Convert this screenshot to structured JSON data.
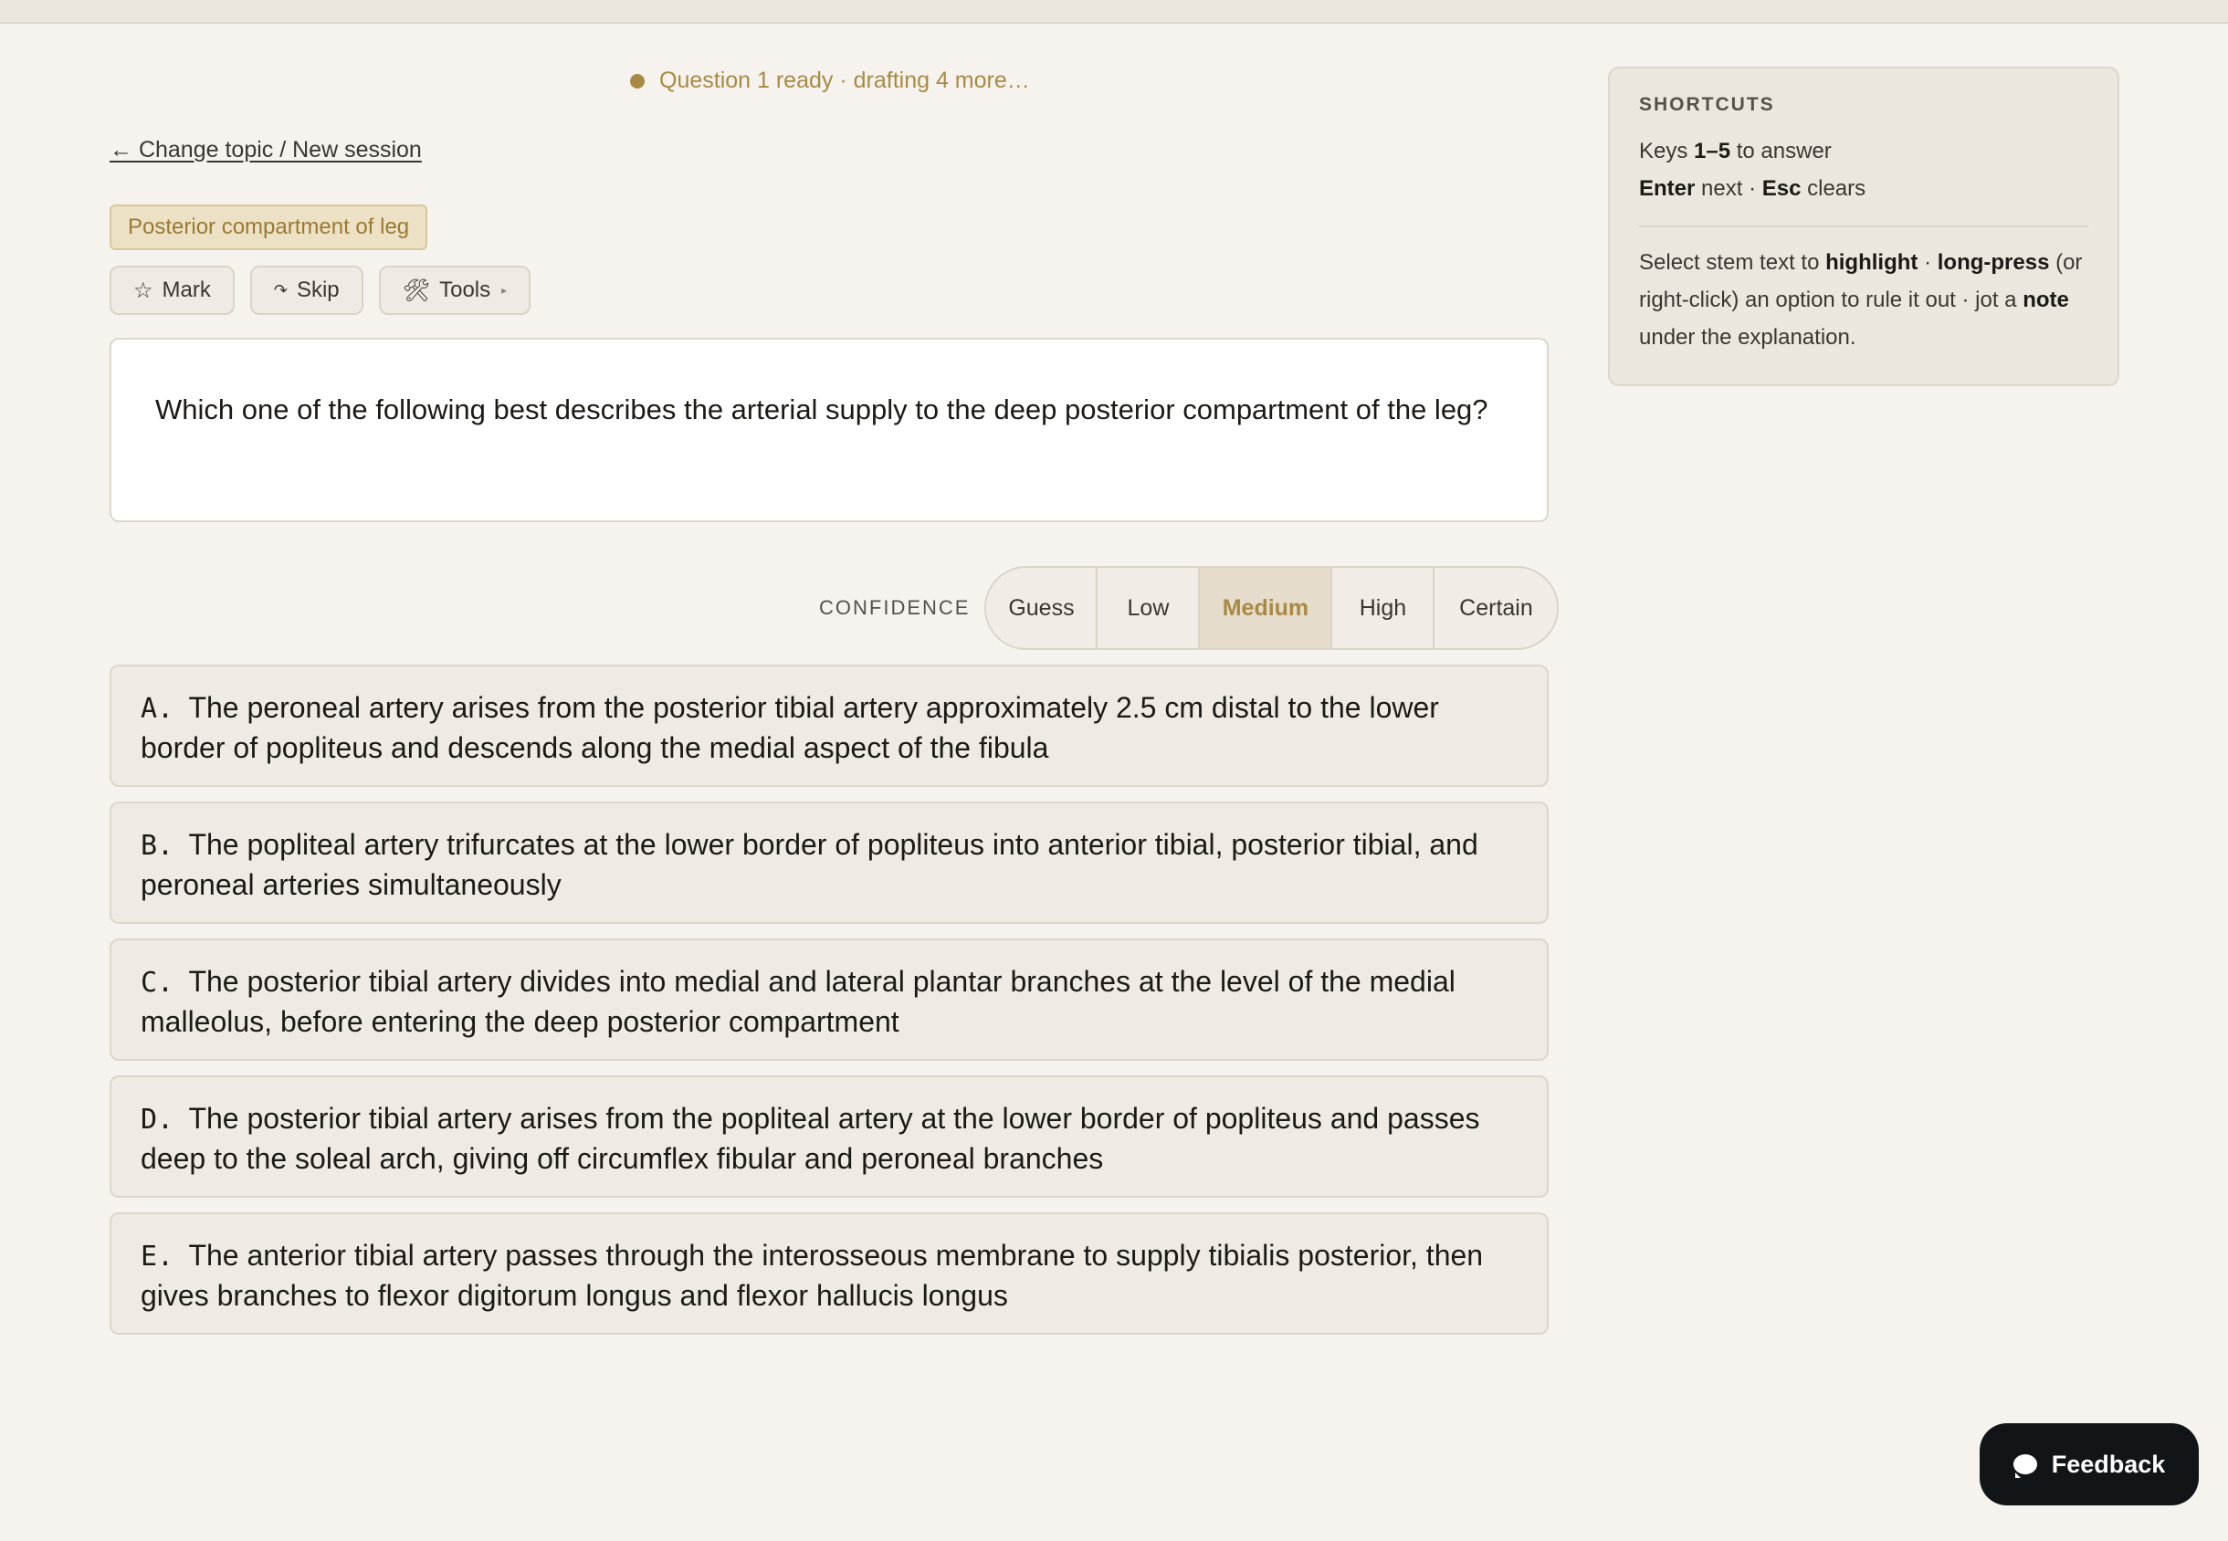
{
  "status": {
    "text": "Question 1 ready · drafting 4 more…"
  },
  "nav": {
    "back_link": "← Change topic / New session"
  },
  "topic": {
    "label": "Posterior compartment of leg"
  },
  "toolbar": {
    "mark_icon": "star-outline-icon",
    "mark_glyph": "☆",
    "mark_label": "Mark",
    "skip_icon": "skip-icon",
    "skip_glyph": "↷",
    "skip_label": "Skip",
    "tools_icon": "tools-icon",
    "tools_glyph": "🛠",
    "tools_label": "Tools",
    "tools_caret": "▸"
  },
  "question": {
    "stem": "Which one of the following best describes the arterial supply to the deep posterior compartment of the leg?"
  },
  "confidence": {
    "label": "CONFIDENCE",
    "selected": "Medium",
    "options": [
      "Guess",
      "Low",
      "Medium",
      "High",
      "Certain"
    ]
  },
  "options": [
    {
      "letter": "A.",
      "text": "The peroneal artery arises from the posterior tibial artery approximately 2.5 cm distal to the lower border of popliteus and descends along the medial aspect of the fibula"
    },
    {
      "letter": "B.",
      "text": "The popliteal artery trifurcates at the lower border of popliteus into anterior tibial, posterior tibial, and peroneal arteries simultaneously"
    },
    {
      "letter": "C.",
      "text": "The posterior tibial artery divides into medial and lateral plantar branches at the level of the medial malleolus, before entering the deep posterior compartment"
    },
    {
      "letter": "D.",
      "text": "The posterior tibial artery arises from the popliteal artery at the lower border of popliteus and passes deep to the soleal arch, giving off circumflex fibular and peroneal branches"
    },
    {
      "letter": "E.",
      "text": "The anterior tibial artery passes through the interosseous membrane to supply tibialis posterior, then gives branches to flexor digitorum longus and flexor hallucis longus"
    }
  ],
  "shortcuts": {
    "title": "SHORTCUTS",
    "keys": "1–5",
    "to_answer": "to answer",
    "enter": "Enter",
    "next": "next ·",
    "esc": "Esc",
    "clears": "clears",
    "select_text": "Select stem text to",
    "highlight": "highlight",
    "dot": "·",
    "long_press": "long-press",
    "rule_out": "(or right-click) an option to rule it out · jot a",
    "note": "note",
    "under": "under the explanation."
  },
  "feedback": {
    "icon": "chat-bubble-icon",
    "label": "Feedback"
  },
  "colors": {
    "background": "#f6f3ee",
    "accent": "#a88a45",
    "chip_bg": "#ece1c4",
    "feedback_bg": "#121518"
  }
}
